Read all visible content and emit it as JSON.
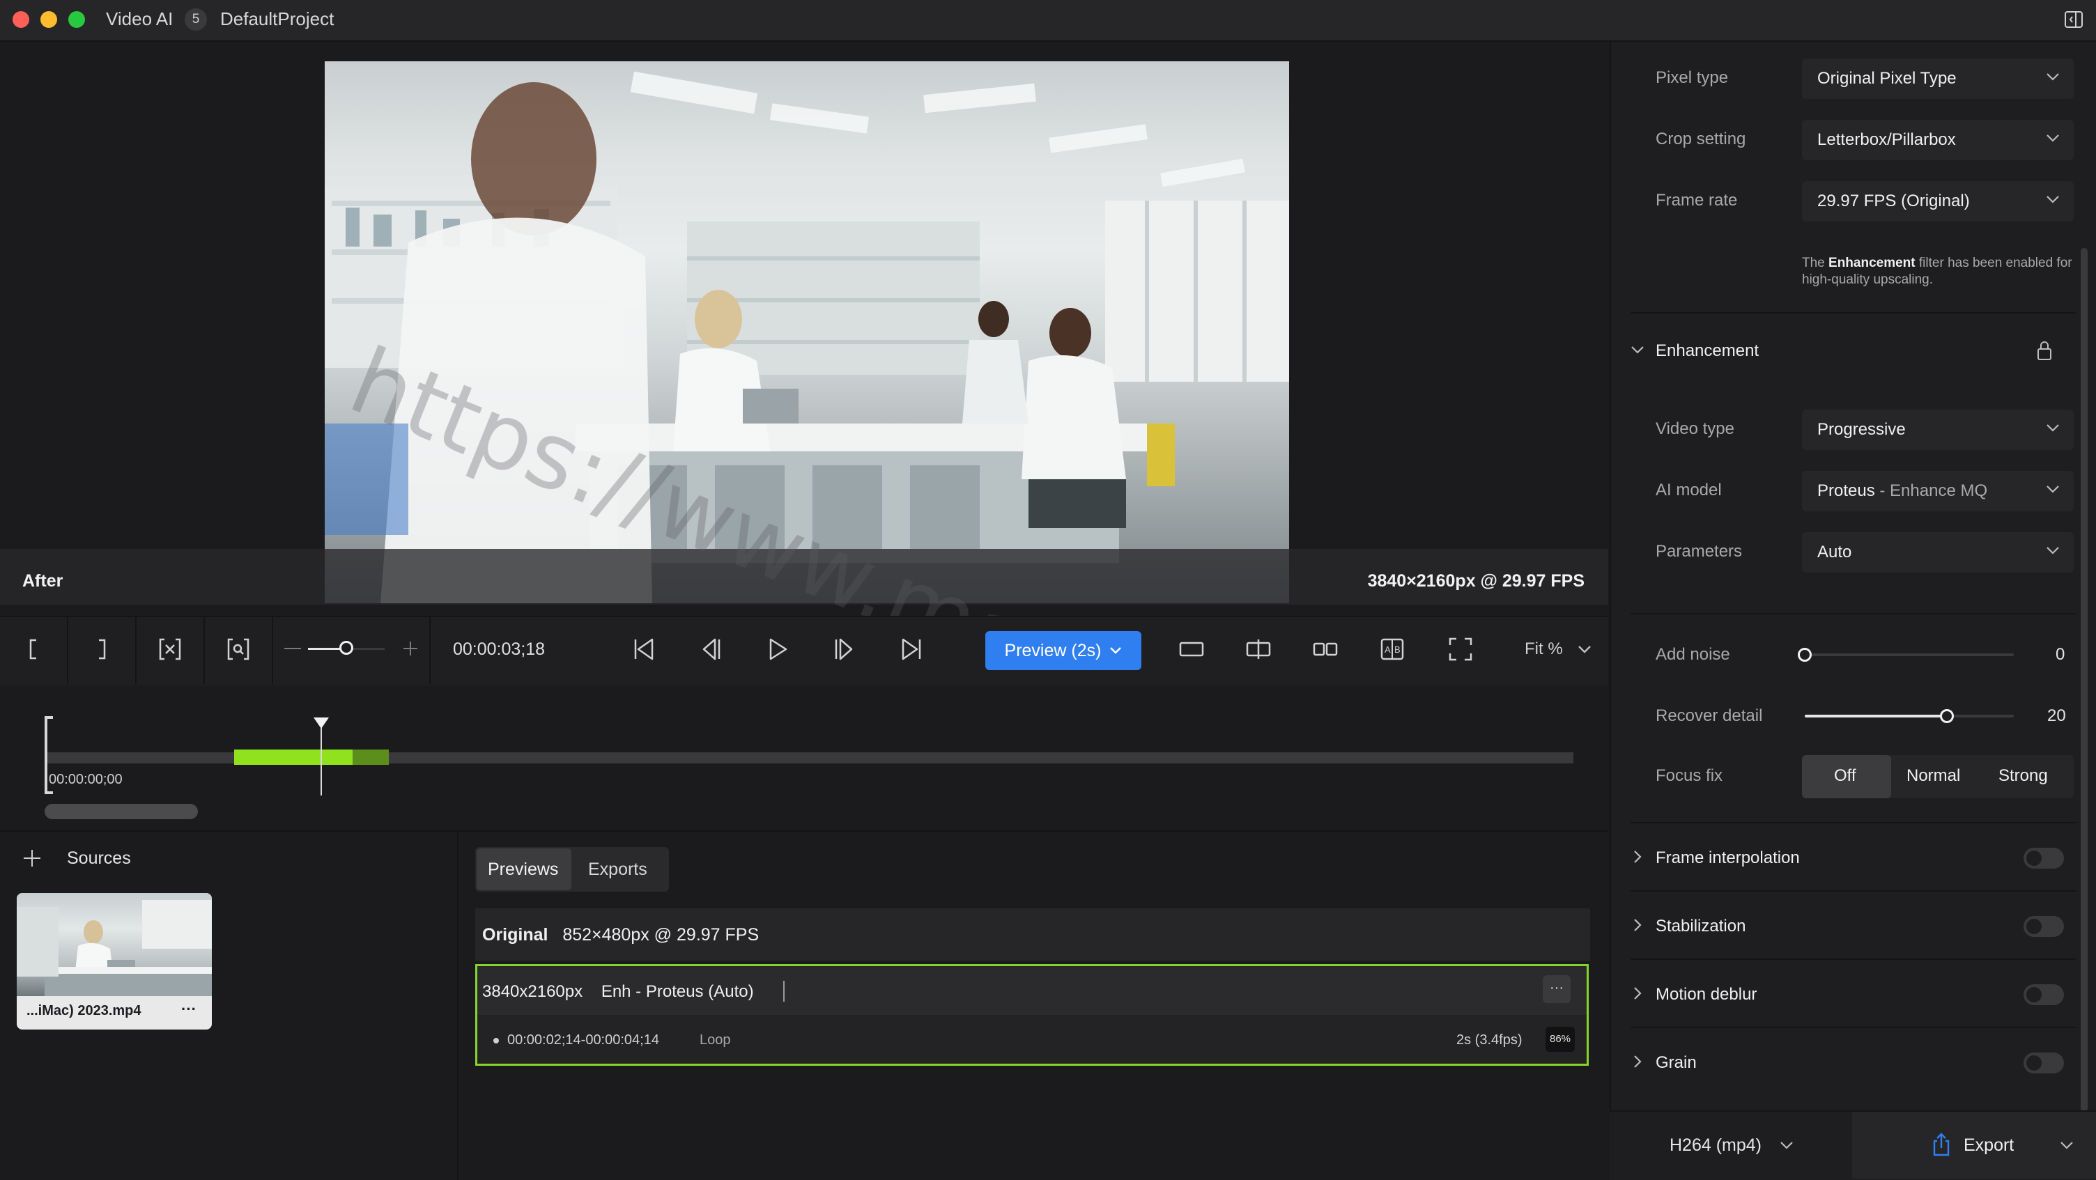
{
  "titlebar": {
    "app_name": "Video AI",
    "project_count": "5",
    "project_name": "DefaultProject"
  },
  "viewer": {
    "after_label": "After",
    "output_info": "3840×2160px @ 29.97 FPS",
    "watermark": "https://www.macku.pro/"
  },
  "toolbar": {
    "timecode": "00:00:03;18",
    "preview_label": "Preview (2s)",
    "zoom_label": "Fit %",
    "zoom_slider_level": 0.5
  },
  "timeline": {
    "start_time": "00:00:00;00"
  },
  "sources": {
    "label": "Sources",
    "file_name": "...iMac) 2023.mp4",
    "more": "···"
  },
  "previews": {
    "tabs": [
      "Previews",
      "Exports"
    ],
    "original": {
      "label": "Original",
      "info": "852×480px @ 29.97 FPS"
    },
    "enhanced": {
      "resolution": "3840x2160px",
      "model": "Enh - Proteus (Auto)",
      "more": "···",
      "range": "00:00:02;14-00:00:04;14",
      "loop": "Loop",
      "duration": "2s (3.4fps)",
      "percent": "86%"
    }
  },
  "settings": {
    "pixel_type": {
      "label": "Pixel type",
      "value": "Original Pixel Type"
    },
    "crop_setting": {
      "label": "Crop setting",
      "value": "Letterbox/Pillarbox"
    },
    "frame_rate": {
      "label": "Frame rate",
      "value": "29.97 FPS (Original)"
    },
    "note_prefix": "The ",
    "note_bold": "Enhancement",
    "note_suffix": " filter has been enabled for high-quality upscaling.",
    "enhancement": {
      "title": "Enhancement",
      "video_type": {
        "label": "Video type",
        "value": "Progressive"
      },
      "ai_model": {
        "label": "AI model",
        "value_main": "Proteus",
        "value_sub": " - Enhance MQ"
      },
      "parameters": {
        "label": "Parameters",
        "value": "Auto"
      },
      "add_noise": {
        "label": "Add noise",
        "value": "0"
      },
      "recover_detail": {
        "label": "Recover detail",
        "value": "20"
      },
      "focus_fix": {
        "label": "Focus fix",
        "options": [
          "Off",
          "Normal",
          "Strong"
        ],
        "selected": "Off"
      }
    },
    "sections": [
      {
        "title": "Frame interpolation",
        "enabled": false
      },
      {
        "title": "Stabilization",
        "enabled": false
      },
      {
        "title": "Motion deblur",
        "enabled": false
      },
      {
        "title": "Grain",
        "enabled": false
      }
    ],
    "export": {
      "format": "H264 (mp4)",
      "label": "Export"
    }
  },
  "colors": {
    "accent": "#2f7ff0",
    "highlight_green": "#8fe21d",
    "card_border": "#85d62a"
  }
}
